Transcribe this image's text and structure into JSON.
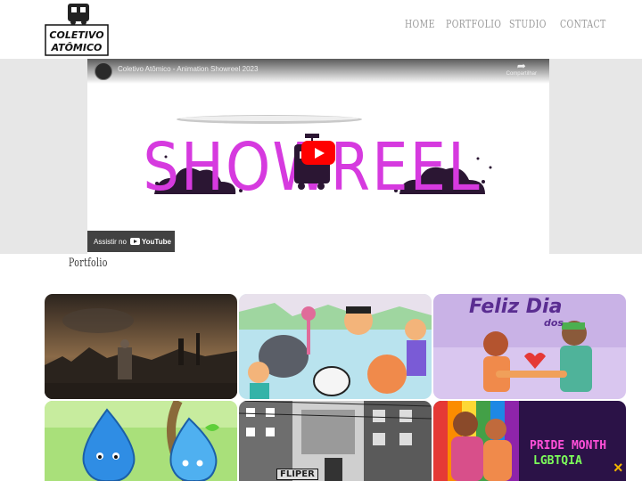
{
  "header": {
    "logo_text": "COLETIVO ATÔMICO",
    "nav": {
      "home": "HOME",
      "portfolio": "PORTFOLIO",
      "studio": "STUDIO",
      "contact": "CONTACT"
    }
  },
  "video": {
    "title": "Coletivo Atômico - Animation Showreel 2023",
    "share_label": "Compartilhar",
    "showreel_text": "SHOWREEL",
    "watch_on": "Assistir no",
    "youtube_label": "YouTube"
  },
  "portfolio": {
    "heading": "Portfolio",
    "tiles": [
      {
        "name": "dark-city-scene"
      },
      {
        "name": "cartoon-characters"
      },
      {
        "name": "feliz-dia",
        "line1": "Feliz Dia",
        "line2": "dos"
      },
      {
        "name": "water-drops"
      },
      {
        "name": "city-street",
        "sign": "FLIPER"
      },
      {
        "name": "pride-month",
        "line1": "PRIDE MONTH",
        "line2": "LGBTQIA"
      }
    ]
  },
  "close_label": "×",
  "colors": {
    "band": "#e7e7e7",
    "showreel_magenta": "#d63adf",
    "youtube_red": "#ff0000",
    "pride_pink": "#ff4fd8",
    "pride_green": "#7cff5a",
    "close_yellow": "#f0b400"
  }
}
